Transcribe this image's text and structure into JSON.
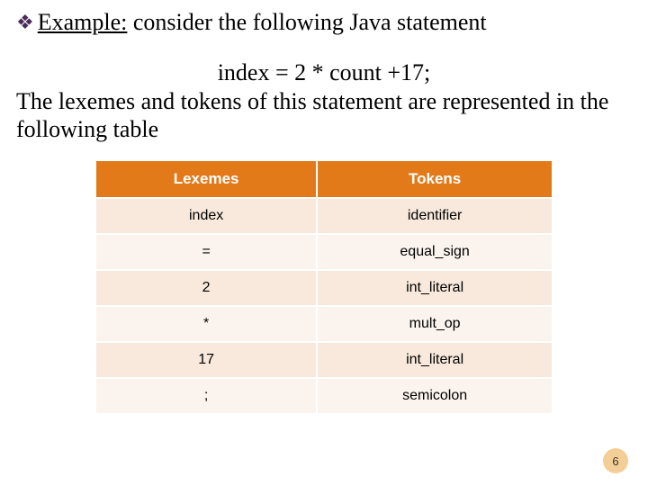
{
  "heading": {
    "label": "Example:",
    "rest": " consider the following Java statement"
  },
  "code": "index = 2 * count +17;",
  "desc": "The lexemes and tokens of this statement are represented in the following table",
  "table": {
    "headers": [
      "Lexemes",
      "Tokens"
    ],
    "rows": [
      [
        "index",
        "identifier"
      ],
      [
        "=",
        "equal_sign"
      ],
      [
        "2",
        "int_literal"
      ],
      [
        "*",
        "mult_op"
      ],
      [
        "17",
        "int_literal"
      ],
      [
        ";",
        "semicolon"
      ]
    ]
  },
  "page": "6"
}
